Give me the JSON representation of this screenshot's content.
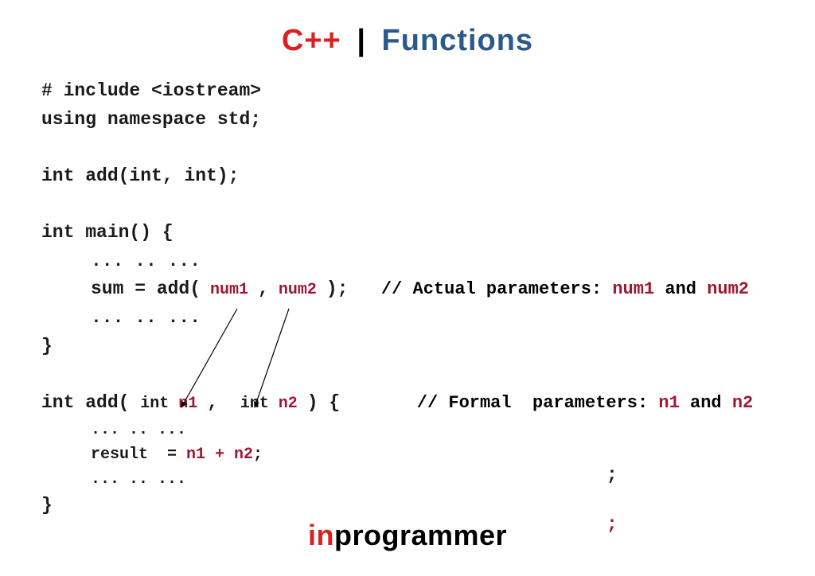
{
  "header": {
    "cpp": "C++",
    "sep": "|",
    "functions": "Functions"
  },
  "code": {
    "line1": "# include <iostream>",
    "line2": "using namespace std;",
    "line3": "int add(int, int);",
    "line4": "int main() {",
    "dots": "... .. ...",
    "sum_prefix": "sum = add(",
    "num1": " num1 ",
    "comma": ",",
    "num2": " num2 ",
    "sum_suffix": ");",
    "comment1_a": "// Actual parameters: ",
    "comment1_b": "num1",
    "comment1_c": " and ",
    "comment1_d": "num2",
    "close_brace": "}",
    "addfn_prefix": "int add( ",
    "int_kw": "int ",
    "n1": "n1 ",
    "n2": "n2 ",
    "addfn_suffix": ") {",
    "comment2_a": "// Formal  parameters: ",
    "comment2_b": "n1",
    "comment2_c": " and ",
    "comment2_d": "n2",
    "result_a": "result  = ",
    "result_b": "n1 + n2",
    "result_c": ";",
    "semi": ";"
  },
  "footer": {
    "in": "in",
    "programmer": "programmer"
  }
}
